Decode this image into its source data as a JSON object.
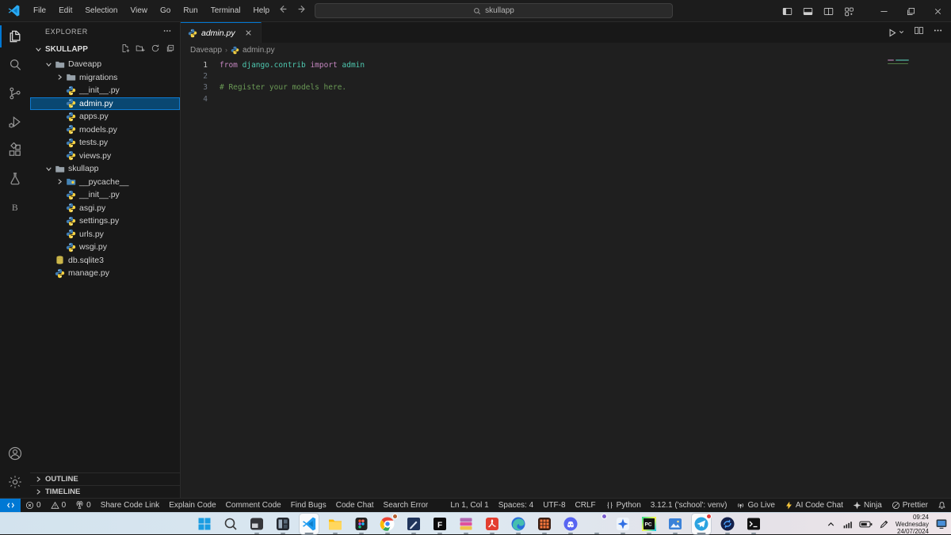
{
  "titlebar": {
    "menus": [
      "File",
      "Edit",
      "Selection",
      "View",
      "Go",
      "Run",
      "Terminal",
      "Help"
    ],
    "search_value": "skullapp"
  },
  "activity_bar": {
    "top": [
      {
        "id": "explorer",
        "active": true
      },
      {
        "id": "search"
      },
      {
        "id": "source-control"
      },
      {
        "id": "run-debug"
      },
      {
        "id": "extensions"
      },
      {
        "id": "testing"
      },
      {
        "id": "b-ext"
      }
    ],
    "bottom": [
      {
        "id": "accounts"
      },
      {
        "id": "settings"
      }
    ]
  },
  "sidebar": {
    "title": "EXPLORER",
    "section_label": "SKULLAPP",
    "tree": [
      {
        "label": "Daveapp",
        "icon": "folder",
        "indent": 0,
        "expanded": true
      },
      {
        "label": "migrations",
        "icon": "folder",
        "indent": 1,
        "collapsed": true
      },
      {
        "label": "__init__.py",
        "icon": "python",
        "indent": 1
      },
      {
        "label": "admin.py",
        "icon": "python",
        "indent": 1,
        "selected": true
      },
      {
        "label": "apps.py",
        "icon": "python",
        "indent": 1
      },
      {
        "label": "models.py",
        "icon": "python",
        "indent": 1
      },
      {
        "label": "tests.py",
        "icon": "python",
        "indent": 1
      },
      {
        "label": "views.py",
        "icon": "python",
        "indent": 1
      },
      {
        "label": "skullapp",
        "icon": "folder",
        "indent": 0,
        "expanded": true
      },
      {
        "label": "__pycache__",
        "icon": "folder-python",
        "indent": 1,
        "collapsed": true
      },
      {
        "label": "__init__.py",
        "icon": "python",
        "indent": 1
      },
      {
        "label": "asgi.py",
        "icon": "python",
        "indent": 1
      },
      {
        "label": "settings.py",
        "icon": "python",
        "indent": 1
      },
      {
        "label": "urls.py",
        "icon": "python",
        "indent": 1
      },
      {
        "label": "wsgi.py",
        "icon": "python",
        "indent": 1
      },
      {
        "label": "db.sqlite3",
        "icon": "database",
        "indent": 0
      },
      {
        "label": "manage.py",
        "icon": "python",
        "indent": 0
      }
    ],
    "panels": [
      "OUTLINE",
      "TIMELINE"
    ]
  },
  "editor": {
    "tab_label": "admin.py",
    "breadcrumb": [
      "Daveapp",
      "admin.py"
    ],
    "code_lines": [
      {
        "n": "1",
        "tokens": [
          {
            "t": "from",
            "c": "kw"
          },
          {
            "t": " ",
            "c": "pl"
          },
          {
            "t": "django.contrib",
            "c": "ns"
          },
          {
            "t": " ",
            "c": "pl"
          },
          {
            "t": "import",
            "c": "kw"
          },
          {
            "t": " ",
            "c": "pl"
          },
          {
            "t": "admin",
            "c": "ns"
          }
        ]
      },
      {
        "n": "2",
        "tokens": []
      },
      {
        "n": "3",
        "tokens": [
          {
            "t": "# Register your models here.",
            "c": "cm"
          }
        ]
      },
      {
        "n": "4",
        "tokens": []
      }
    ]
  },
  "status_bar": {
    "left": [
      {
        "icon": "remote",
        "label": "",
        "accent": true
      },
      {
        "icon": "error",
        "label": "0"
      },
      {
        "icon": "warning",
        "label": "0"
      },
      {
        "icon": "tower",
        "label": "0"
      },
      {
        "label": "Share Code Link"
      },
      {
        "label": "Explain Code"
      },
      {
        "label": "Comment Code"
      },
      {
        "label": "Find Bugs"
      },
      {
        "label": "Code Chat"
      },
      {
        "label": "Search Error"
      }
    ],
    "right": [
      {
        "label": "Ln 1, Col 1"
      },
      {
        "label": "Spaces: 4"
      },
      {
        "label": "UTF-8"
      },
      {
        "label": "CRLF"
      },
      {
        "icon": "braces",
        "label": "Python"
      },
      {
        "label": "3.12.1 ('school': venv)"
      },
      {
        "icon": "broadcast",
        "label": "Go Live"
      },
      {
        "icon": "zap",
        "label": "AI Code Chat"
      },
      {
        "icon": "shuriken",
        "label": "Ninja"
      },
      {
        "icon": "slash",
        "label": "Prettier"
      },
      {
        "icon": "bell",
        "label": ""
      }
    ]
  },
  "taskbar": {
    "apps": [
      {
        "id": "start"
      },
      {
        "id": "search"
      },
      {
        "id": "app-dark",
        "running": true
      },
      {
        "id": "app-widgets",
        "running": true
      },
      {
        "id": "vscode",
        "active": true,
        "running": true
      },
      {
        "id": "explorer",
        "running": true
      },
      {
        "id": "figma",
        "running": true
      },
      {
        "id": "chrome",
        "running": true,
        "badge": true
      },
      {
        "id": "pen-app",
        "running": true
      },
      {
        "id": "f-app",
        "running": true
      },
      {
        "id": "winrar",
        "running": true
      },
      {
        "id": "acrobat",
        "running": true
      },
      {
        "id": "edge",
        "running": true
      },
      {
        "id": "grid-app",
        "running": true
      },
      {
        "id": "discord",
        "running": true
      },
      {
        "id": "chrome2",
        "running": true,
        "badge": true
      },
      {
        "id": "star-app",
        "running": true
      },
      {
        "id": "pycharm",
        "running": true
      },
      {
        "id": "photos",
        "running": true
      },
      {
        "id": "telegram",
        "active": true,
        "running": true,
        "badge": true
      },
      {
        "id": "sync-app",
        "running": true
      },
      {
        "id": "terminal",
        "running": true
      }
    ],
    "tray": {
      "time": "09:24",
      "day": "Wednesday",
      "date": "24/07/2024"
    }
  }
}
